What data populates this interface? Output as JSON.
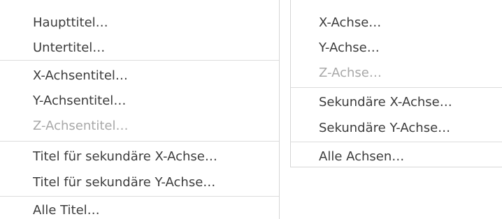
{
  "titles_menu": {
    "items": [
      {
        "label": "Haupttitel…",
        "enabled": true
      },
      {
        "label": "Untertitel…",
        "enabled": true
      },
      {
        "label": "X-Achsentitel…",
        "enabled": true
      },
      {
        "label": "Y-Achsentitel…",
        "enabled": true
      },
      {
        "label": "Z-Achsentitel…",
        "enabled": false
      },
      {
        "label": "Titel für sekundäre X-Achse…",
        "enabled": true
      },
      {
        "label": "Titel für sekundäre Y-Achse…",
        "enabled": true
      },
      {
        "label": "Alle Titel…",
        "enabled": true
      }
    ]
  },
  "axes_menu": {
    "items": [
      {
        "label": "X-Achse…",
        "enabled": true
      },
      {
        "label": "Y-Achse…",
        "enabled": true
      },
      {
        "label": "Z-Achse…",
        "enabled": false
      },
      {
        "label": "Sekundäre X-Achse…",
        "enabled": true
      },
      {
        "label": "Sekundäre Y-Achse…",
        "enabled": true
      },
      {
        "label": "Alle Achsen…",
        "enabled": true
      }
    ]
  },
  "colors": {
    "text": "#3c3c3c",
    "disabled_text": "#a8a8a8",
    "separator": "#dcdcdc",
    "background": "#ffffff"
  }
}
